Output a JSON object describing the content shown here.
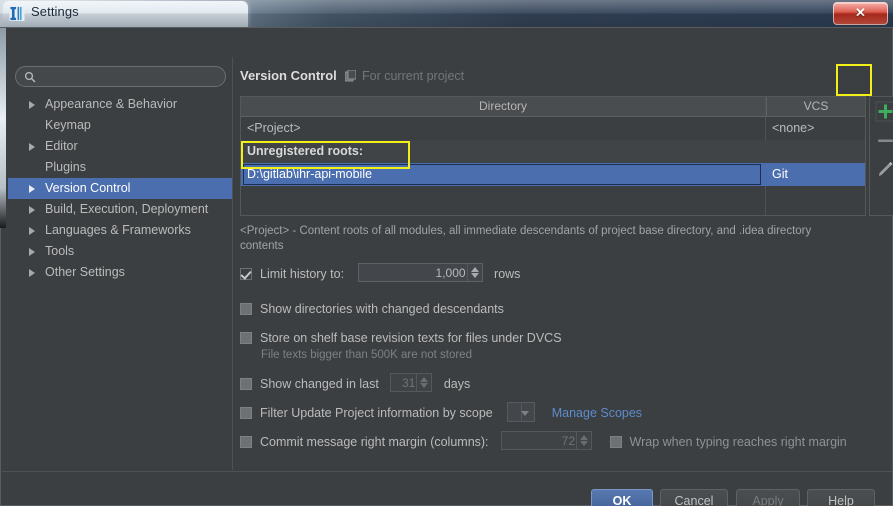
{
  "window": {
    "title": "Settings",
    "app_icon": "intellij-icon",
    "close_label": "✕"
  },
  "sidebar": {
    "search": {
      "value": "",
      "placeholder": ""
    },
    "items": [
      {
        "label": "Appearance & Behavior",
        "expandable": true,
        "selected": false
      },
      {
        "label": "Keymap",
        "expandable": false,
        "selected": false
      },
      {
        "label": "Editor",
        "expandable": true,
        "selected": false
      },
      {
        "label": "Plugins",
        "expandable": false,
        "selected": false
      },
      {
        "label": "Version Control",
        "expandable": true,
        "selected": true
      },
      {
        "label": "Build, Execution, Deployment",
        "expandable": true,
        "selected": false
      },
      {
        "label": "Languages & Frameworks",
        "expandable": true,
        "selected": false
      },
      {
        "label": "Tools",
        "expandable": true,
        "selected": false
      },
      {
        "label": "Other Settings",
        "expandable": true,
        "selected": false
      }
    ]
  },
  "content": {
    "page_title": "Version Control",
    "scope_note": "For current project",
    "table": {
      "columns": [
        "Directory",
        "VCS"
      ],
      "rows": [
        {
          "directory": "<Project>",
          "vcs": "<none>",
          "type": "item",
          "selected": false
        },
        {
          "directory": "Unregistered roots:",
          "vcs": "",
          "type": "group",
          "selected": false
        },
        {
          "directory": "D:\\gitlab\\ihr-api-mobile",
          "vcs": "Git",
          "type": "item",
          "selected": true
        }
      ]
    },
    "toolbar": {
      "add_label": "+",
      "remove_label": "–",
      "edit_label": "edit-pencil-icon"
    },
    "description": "<Project> - Content roots of all modules, all immediate descendants of project base directory, and .idea directory contents",
    "options": {
      "limit_history": {
        "label": "Limit history to:",
        "checked": true,
        "value": "1,000",
        "suffix": "rows"
      },
      "show_directories": {
        "label": "Show directories with changed descendants",
        "checked": false
      },
      "store_on_shelf": {
        "label": "Store on shelf base revision texts for files under DVCS",
        "checked": false,
        "note": "File texts bigger than 500K are not stored"
      },
      "show_changed_in_last": {
        "label": "Show changed in last",
        "checked": false,
        "value": "31",
        "suffix": "days"
      },
      "filter_update": {
        "label": "Filter Update Project information by scope",
        "checked": false,
        "scope_value": "",
        "link": "Manage Scopes"
      },
      "commit_margin": {
        "label": "Commit message right margin (columns):",
        "checked": false,
        "value": "72"
      },
      "wrap_typing": {
        "label": "Wrap when typing reaches right margin",
        "checked": false
      }
    }
  },
  "buttons": {
    "ok": "OK",
    "cancel": "Cancel",
    "apply": "Apply",
    "help": "Help"
  },
  "colors": {
    "accent_selection": "#4b6eaf",
    "background": "#3c3f41",
    "annotation": "#f2f018",
    "add_icon_green": "#3cae5e",
    "link": "#5c8ccb"
  }
}
